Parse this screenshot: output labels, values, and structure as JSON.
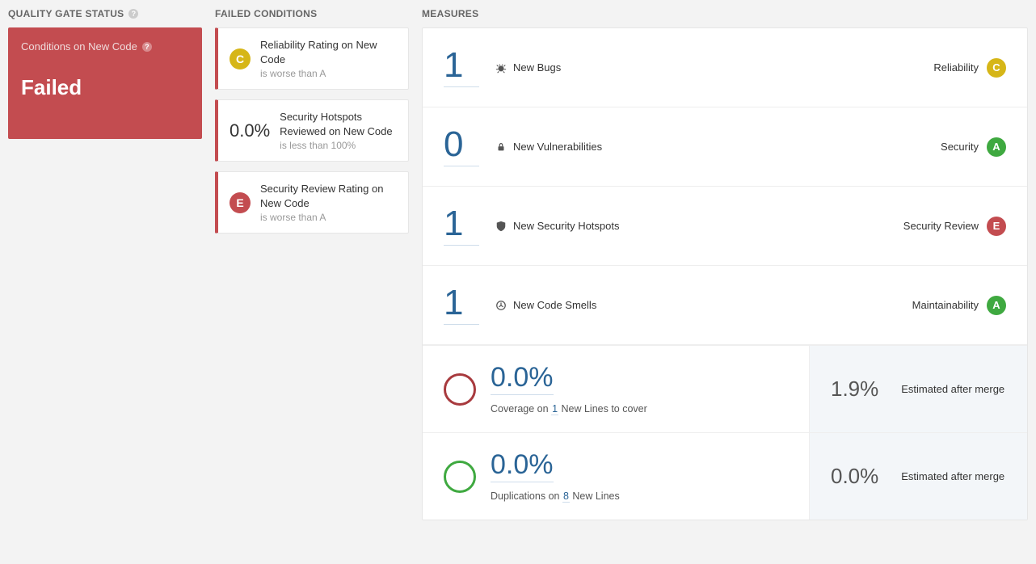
{
  "headings": {
    "quality_gate": "QUALITY GATE STATUS",
    "failed_conditions": "FAILED CONDITIONS",
    "measures": "MEASURES"
  },
  "quality_gate": {
    "subtitle": "Conditions on New Code",
    "status": "Failed"
  },
  "failed_conditions": [
    {
      "kind": "rating",
      "rating": "C",
      "title": "Reliability Rating on New Code",
      "meta": "is worse than A"
    },
    {
      "kind": "percent",
      "percent": "0.0%",
      "title": "Security Hotspots Reviewed on New Code",
      "meta": "is less than 100%"
    },
    {
      "kind": "rating",
      "rating": "E",
      "title": "Security Review Rating on New Code",
      "meta": "is worse than A"
    }
  ],
  "measures": [
    {
      "count": "1",
      "icon": "bug",
      "label": "New Bugs",
      "category": "Reliability",
      "rating": "C"
    },
    {
      "count": "0",
      "icon": "lock",
      "label": "New Vulnerabilities",
      "category": "Security",
      "rating": "A"
    },
    {
      "count": "1",
      "icon": "shield",
      "label": "New Security Hotspots",
      "category": "Security Review",
      "rating": "E"
    },
    {
      "count": "1",
      "icon": "smell",
      "label": "New Code Smells",
      "category": "Maintainability",
      "rating": "A"
    }
  ],
  "coverage": {
    "percent": "0.0%",
    "sub_prefix": "Coverage on ",
    "sub_count": "1",
    "sub_suffix": " New Lines to cover",
    "est_value": "1.9%",
    "est_label": "Estimated after merge"
  },
  "duplications": {
    "percent": "0.0%",
    "sub_prefix": "Duplications on ",
    "sub_count": "8",
    "sub_suffix": " New Lines",
    "est_value": "0.0%",
    "est_label": "Estimated after merge"
  }
}
